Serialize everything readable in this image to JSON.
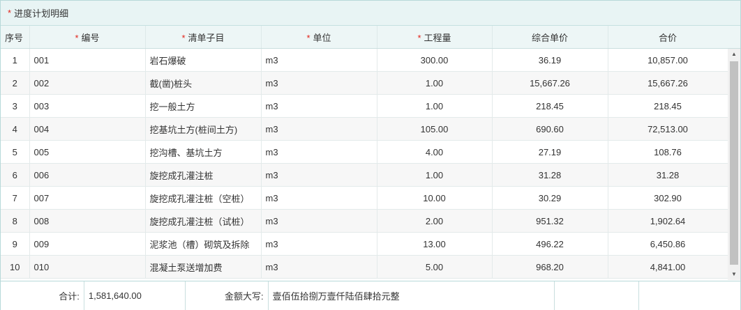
{
  "panel": {
    "title": "进度计划明细",
    "required_mark": "*"
  },
  "columns": [
    {
      "label": "序号",
      "required": false
    },
    {
      "label": "编号",
      "required": true
    },
    {
      "label": "清单子目",
      "required": true
    },
    {
      "label": "单位",
      "required": true
    },
    {
      "label": "工程量",
      "required": true
    },
    {
      "label": "综合单价",
      "required": false
    },
    {
      "label": "合价",
      "required": false
    }
  ],
  "rows": [
    {
      "seq": "1",
      "code": "001",
      "item": "岩石爆破",
      "unit": "m3",
      "qty": "300.00",
      "price": "36.19",
      "total": "10,857.00"
    },
    {
      "seq": "2",
      "code": "002",
      "item": "截(凿)桩头",
      "unit": "m3",
      "qty": "1.00",
      "price": "15,667.26",
      "total": "15,667.26"
    },
    {
      "seq": "3",
      "code": "003",
      "item": "挖一般土方",
      "unit": "m3",
      "qty": "1.00",
      "price": "218.45",
      "total": "218.45"
    },
    {
      "seq": "4",
      "code": "004",
      "item": "挖基坑土方(桩间土方)",
      "unit": "m3",
      "qty": "105.00",
      "price": "690.60",
      "total": "72,513.00"
    },
    {
      "seq": "5",
      "code": "005",
      "item": "挖沟槽、基坑土方",
      "unit": "m3",
      "qty": "4.00",
      "price": "27.19",
      "total": "108.76"
    },
    {
      "seq": "6",
      "code": "006",
      "item": "旋挖成孔灌注桩",
      "unit": "m3",
      "qty": "1.00",
      "price": "31.28",
      "total": "31.28"
    },
    {
      "seq": "7",
      "code": "007",
      "item": "旋挖成孔灌注桩（空桩）",
      "unit": "m3",
      "qty": "10.00",
      "price": "30.29",
      "total": "302.90"
    },
    {
      "seq": "8",
      "code": "008",
      "item": "旋挖成孔灌注桩（试桩）",
      "unit": "m3",
      "qty": "2.00",
      "price": "951.32",
      "total": "1,902.64"
    },
    {
      "seq": "9",
      "code": "009",
      "item": "泥浆池（槽）砌筑及拆除",
      "unit": "m3",
      "qty": "13.00",
      "price": "496.22",
      "total": "6,450.86"
    },
    {
      "seq": "10",
      "code": "010",
      "item": "混凝土泵送增加费",
      "unit": "m3",
      "qty": "5.00",
      "price": "968.20",
      "total": "4,841.00"
    }
  ],
  "footer": {
    "sum_label": "合计:",
    "sum_value": "1,581,640.00",
    "caps_label": "金额大写:",
    "caps_value": "壹佰伍拾捌万壹仟陆佰肆拾元整"
  },
  "colors": {
    "required": "#e2231a",
    "header_bg": "#edf6f6",
    "panel_header_bg": "#e8f4f4",
    "border": "#b7d9d9"
  }
}
